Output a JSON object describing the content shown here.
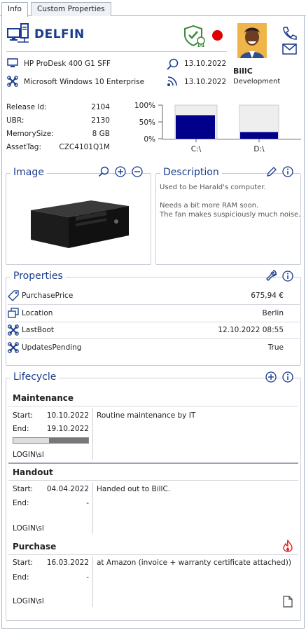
{
  "tabs": [
    {
      "label": "Info",
      "active": true
    },
    {
      "label": "Custom Properties",
      "active": false
    }
  ],
  "header": {
    "device_name": "DELFIN",
    "status_color": "#e00000",
    "model": "HP ProDesk 400 G1 SFF",
    "os": "Microsoft Windows 10 Enterprise",
    "scan_date": "13.10.2022",
    "network_date": "13.10.2022"
  },
  "user": {
    "name": "BillC",
    "department": "Development"
  },
  "specs": [
    {
      "label": "Release Id:",
      "value": "2104"
    },
    {
      "label": "UBR:",
      "value": "2130"
    },
    {
      "label": "MemorySize:",
      "value": "8 GB"
    },
    {
      "label": "AssetTag:",
      "value": "CZC4101Q1M"
    }
  ],
  "chart_data": {
    "type": "bar",
    "categories": [
      "C:\\",
      "D:\\"
    ],
    "values": [
      70,
      20
    ],
    "ylim": [
      0,
      100
    ],
    "ytick_labels": [
      "100%",
      "50%",
      "0%"
    ],
    "ytick_values": [
      100,
      50,
      0
    ],
    "bar_color": "#00008b",
    "background_color": "#eeeeee"
  },
  "image_panel": {
    "title": "Image"
  },
  "description_panel": {
    "title": "Description",
    "lines": [
      "Used to be Harald's computer.",
      "",
      "Needs a bit more RAM soon.",
      "The fan makes suspiciously much noise."
    ]
  },
  "properties_panel": {
    "title": "Properties",
    "rows": [
      {
        "label": "PurchasePrice",
        "value": "675,94 €",
        "icon": "price-tag-icon"
      },
      {
        "label": "Location",
        "value": "Berlin",
        "icon": "location-icon"
      },
      {
        "label": "LastBoot",
        "value": "12.10.2022 08:55",
        "icon": "boot-icon"
      },
      {
        "label": "UpdatesPending",
        "value": "True",
        "icon": "updates-icon"
      }
    ]
  },
  "lifecycle_panel": {
    "title": "Lifecycle",
    "start_label": "Start:",
    "end_label": "End:",
    "entries": [
      {
        "name": "Maintenance",
        "start": "10.10.2022",
        "end": "19.10.2022",
        "note": "Routine maintenance by IT",
        "user": "LOGIN\\sl",
        "progress": 0.48
      },
      {
        "name": "Handout",
        "start": "04.04.2022",
        "end": "-",
        "note": "Handed out to BillC.",
        "user": "LOGIN\\sl"
      },
      {
        "name": "Purchase",
        "start": "16.03.2022",
        "end": "-",
        "note": "at Amazon (invoice + warranty certificate attached))",
        "user": "LOGIN\\sl"
      }
    ]
  }
}
